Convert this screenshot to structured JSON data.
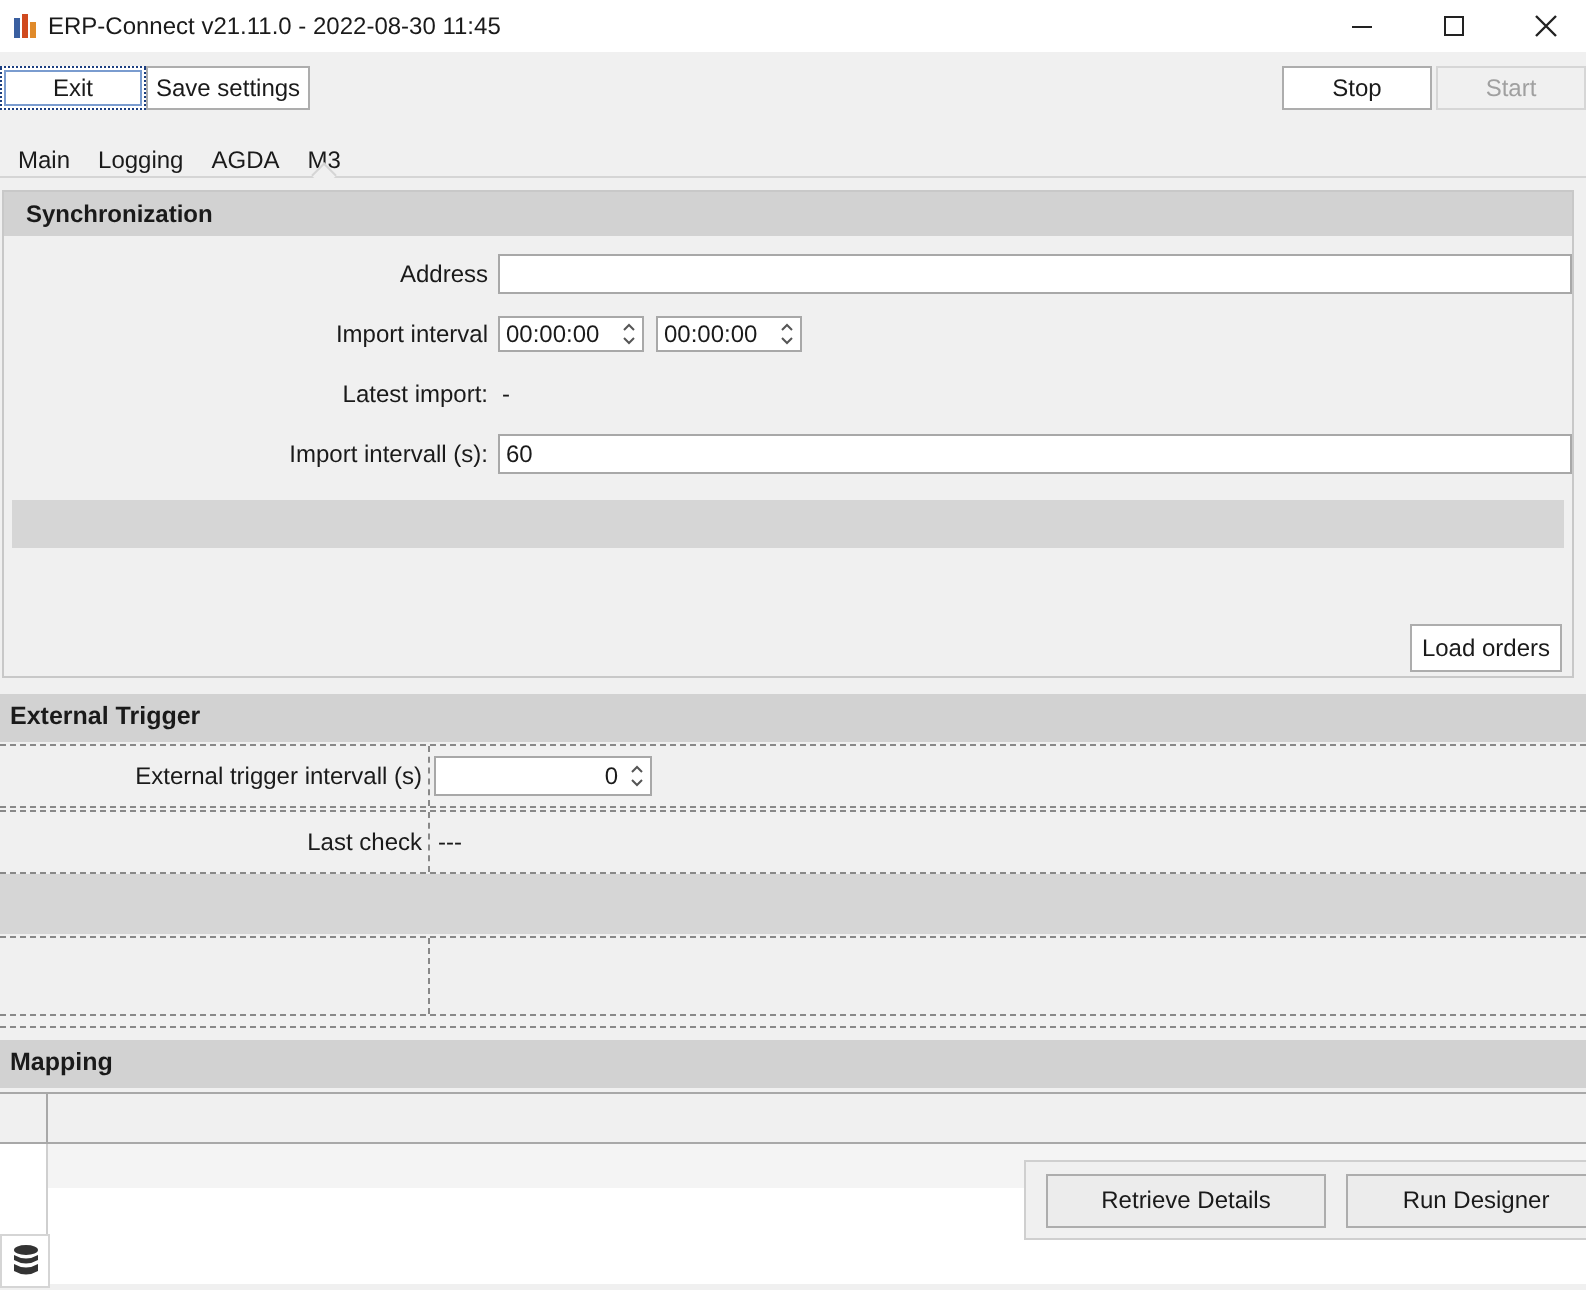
{
  "window": {
    "title": "ERP-Connect v21.11.0 - 2022-08-30 11:45"
  },
  "toolbar": {
    "left": [
      {
        "label": "Exit",
        "focused": true
      },
      {
        "label": "Save settings",
        "focused": false
      }
    ],
    "right": [
      {
        "label": "Stop",
        "disabled": false
      },
      {
        "label": "Start",
        "disabled": true
      }
    ]
  },
  "tabs": [
    {
      "label": "Main",
      "selected": false
    },
    {
      "label": "Logging",
      "selected": false
    },
    {
      "label": "AGDA",
      "selected": false
    },
    {
      "label": "M3",
      "selected": true
    }
  ],
  "synchronization": {
    "title": "Synchronization",
    "rows": [
      {
        "kind": "text",
        "label": "Address"
      },
      {
        "kind": "times",
        "label": "Import interval",
        "values": [
          "00:00:00",
          "00:00:00"
        ]
      },
      {
        "kind": "readout",
        "label": "Latest import:",
        "reading": "-"
      },
      {
        "kind": "text",
        "label": "Import intervall (s):",
        "value": "60"
      }
    ],
    "button": "Load orders"
  },
  "external_trigger": {
    "title": "External Trigger",
    "rows": [
      {
        "kind": "spin",
        "label": "External trigger intervall (s)",
        "value": "0"
      },
      {
        "kind": "readout",
        "label": "Last check",
        "reading": "---"
      }
    ]
  },
  "mapping": {
    "title": "Mapping",
    "buttons": [
      "Retrieve Details",
      "Run Designer"
    ]
  }
}
